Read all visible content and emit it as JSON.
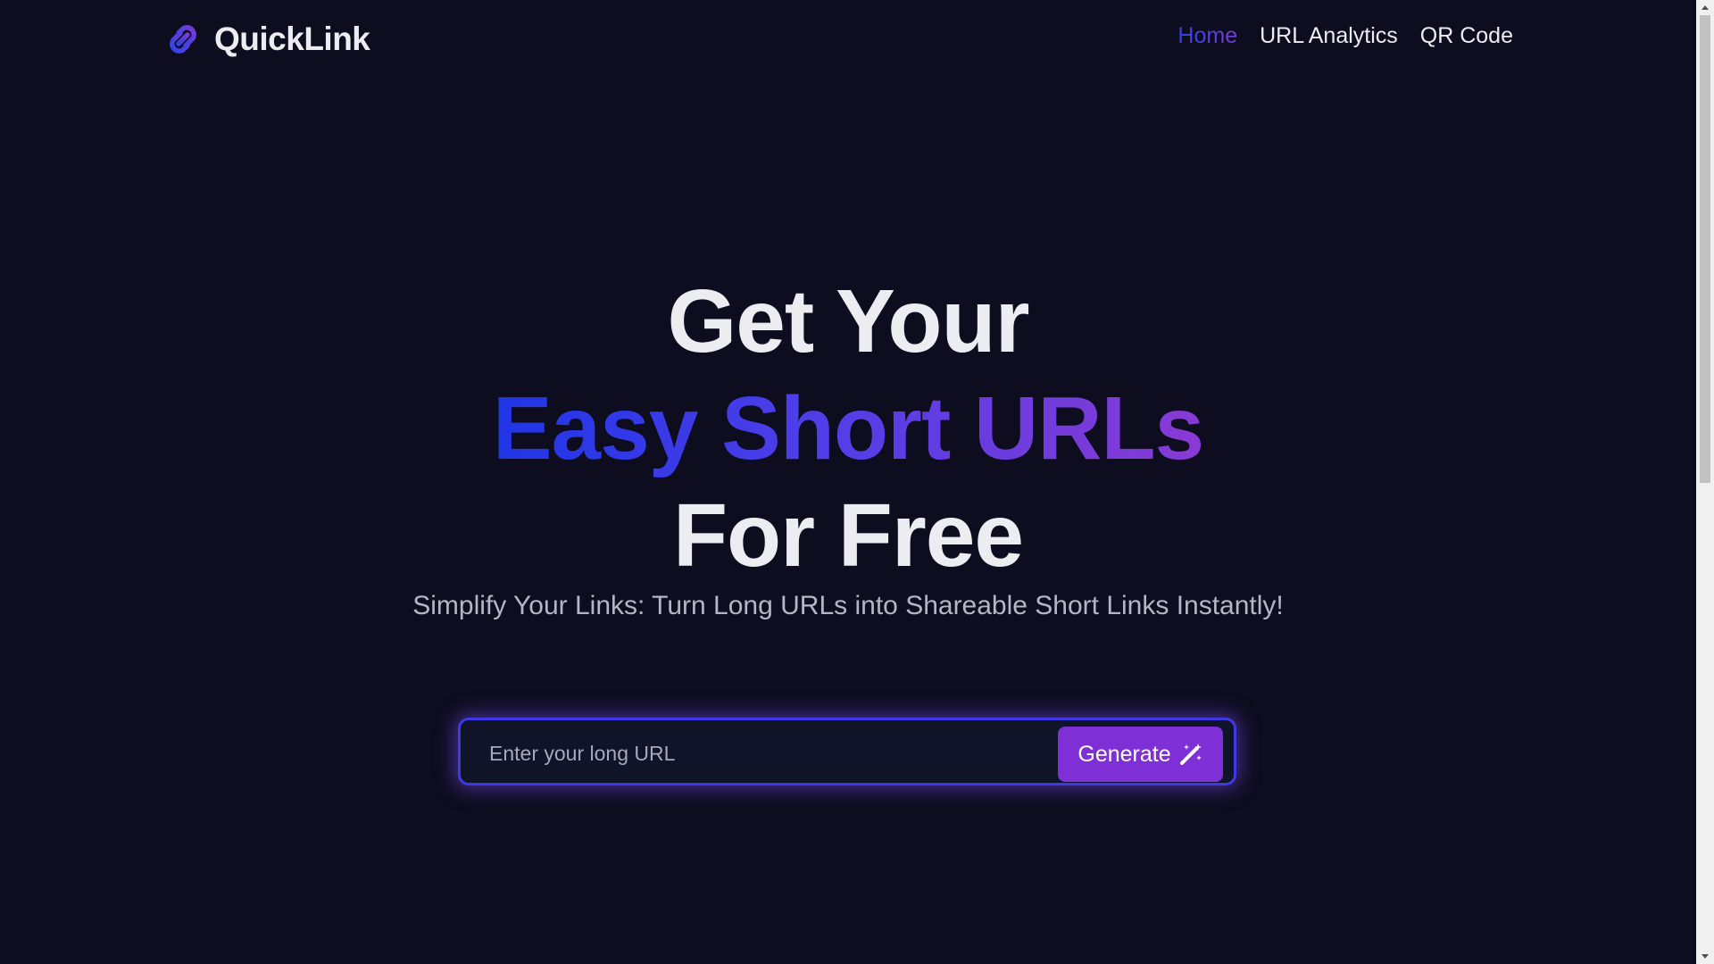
{
  "header": {
    "logo_text": "QuickLink",
    "logo_icon": "link-icon",
    "nav": [
      {
        "label": "Home",
        "active": true
      },
      {
        "label": "URL Analytics",
        "active": false
      },
      {
        "label": "QR Code",
        "active": false
      }
    ]
  },
  "hero": {
    "line1": "Get Your",
    "line2": "Easy Short URLs",
    "line3": "For Free",
    "subtitle": "Simplify Your Links: Turn Long URLs into Shareable Short Links Instantly!"
  },
  "form": {
    "placeholder": "Enter your long URL",
    "value": "",
    "button_label": "Generate",
    "button_icon": "magic-wand-icon"
  },
  "colors": {
    "background": "#0d0d1f",
    "accent_blue": "#1f35e6",
    "accent_purple": "#8a3ad4",
    "button": "#7e30d6",
    "input_border": "#3d39e6"
  }
}
